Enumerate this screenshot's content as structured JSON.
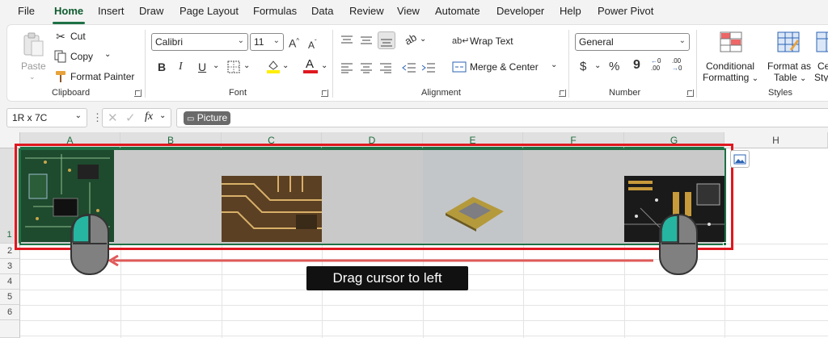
{
  "menu": {
    "tabs": [
      {
        "label": "File"
      },
      {
        "label": "Home"
      },
      {
        "label": "Insert"
      },
      {
        "label": "Draw"
      },
      {
        "label": "Page Layout"
      },
      {
        "label": "Formulas"
      },
      {
        "label": "Data"
      },
      {
        "label": "Review"
      },
      {
        "label": "View"
      },
      {
        "label": "Automate"
      },
      {
        "label": "Developer"
      },
      {
        "label": "Help"
      },
      {
        "label": "Power Pivot"
      }
    ]
  },
  "ribbon": {
    "clipboard": {
      "paste": "Paste",
      "cut": "Cut",
      "copy": "Copy",
      "format_painter": "Format Painter",
      "group": "Clipboard"
    },
    "font": {
      "name": "Calibri",
      "size": "11",
      "grow": "A",
      "shrink": "A",
      "bold": "B",
      "italic": "I",
      "underline": "U",
      "font_color_glyph": "A",
      "group": "Font"
    },
    "alignment": {
      "wrap_text": "Wrap Text",
      "merge_center": "Merge & Center",
      "group": "Alignment"
    },
    "number": {
      "format": "General",
      "currency": "$",
      "percent": "%",
      "comma": "9",
      "group": "Number"
    },
    "styles": {
      "conditional_1": "Conditional",
      "conditional_2": "Formatting",
      "format_table_1": "Format as",
      "format_table_2": "Table",
      "cell_styles_1": "Ce",
      "cell_styles_2": "Style",
      "group": "Styles"
    }
  },
  "formula_bar": {
    "name_box": "1R x 7C",
    "fx": "fx",
    "content_pill": "Picture"
  },
  "grid": {
    "columns": [
      "A",
      "B",
      "C",
      "D",
      "E",
      "F",
      "G",
      "H"
    ],
    "rows": [
      "1",
      "2",
      "3",
      "4",
      "5",
      "6"
    ]
  },
  "annotation": {
    "callout": "Drag cursor to left"
  },
  "colors": {
    "accent_green": "#1e7145",
    "highlight_red": "#e0181f",
    "arrow_red": "#e05a5a",
    "mouse_body": "#808080",
    "mouse_button": "#26b5a0"
  }
}
